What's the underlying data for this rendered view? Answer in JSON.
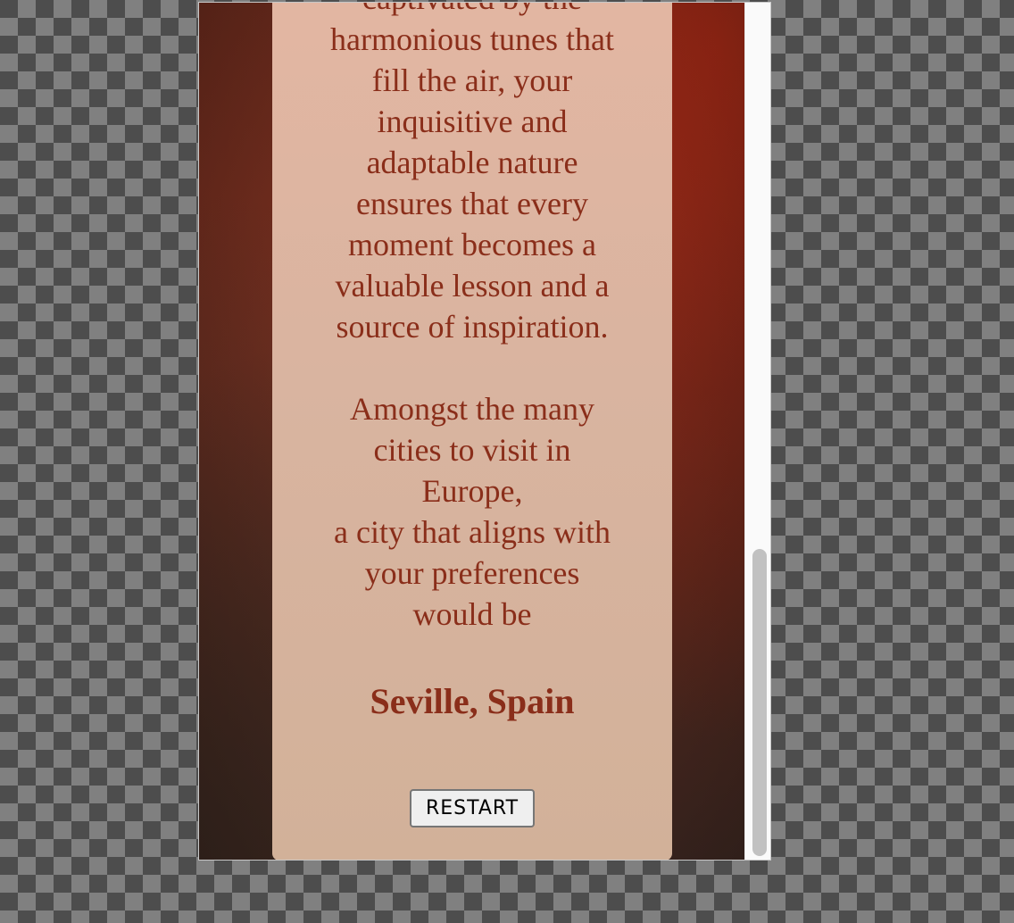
{
  "result": {
    "paragraph_1_lines": [
      "captivated by the",
      "harmonious tunes that",
      "fill the air, your",
      "inquisitive and",
      "adaptable nature",
      "ensures that every",
      "moment becomes a",
      "valuable lesson and a",
      "source of inspiration."
    ],
    "paragraph_2_lines": [
      "Amongst the many",
      "cities to visit in",
      "Europe,",
      "a city that aligns with",
      "your preferences",
      "would be"
    ],
    "city": "Seville, Spain",
    "restart_label": "RESTART"
  },
  "colors": {
    "text": "#8a2e1a",
    "card": "#d9b4a0",
    "background": "#6a2a1c"
  }
}
